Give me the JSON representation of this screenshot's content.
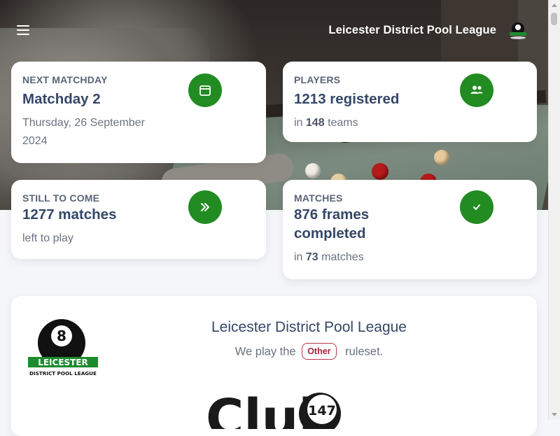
{
  "header": {
    "title": "Leicester District Pool League",
    "menu_icon": "menu-icon",
    "logo_text": "LEICESTER"
  },
  "cards": {
    "next_matchday": {
      "label": "NEXT MATCHDAY",
      "value": "Matchday 2",
      "sub": "Thursday, 26 September 2024",
      "icon": "calendar-icon"
    },
    "players": {
      "label": "PLAYERS",
      "value": "1213 registered",
      "sub_prefix": "in",
      "sub_count": "148",
      "sub_suffix": "teams",
      "icon": "users-icon"
    },
    "still_to_come": {
      "label": "STILL TO COME",
      "value": "1277 matches",
      "sub": "left to play",
      "icon": "chevrons-right-icon"
    },
    "matches": {
      "label": "MATCHES",
      "value": "876 frames completed",
      "sub_prefix": "in",
      "sub_count": "73",
      "sub_suffix": "matches",
      "icon": "check-icon"
    }
  },
  "panel": {
    "title": "Leicester District Pool League",
    "sub_prefix": "We play the",
    "ruleset": "Other",
    "sub_suffix": "ruleset.",
    "league_logo": {
      "ball_number": "8",
      "line1": "LEICESTER",
      "line2": "DISTRICT POOL LEAGUE"
    },
    "club_logo": {
      "text": "Club",
      "number": "147"
    }
  },
  "colors": {
    "accent": "#228b22",
    "badge": "#b9364a",
    "text": "#344767"
  }
}
